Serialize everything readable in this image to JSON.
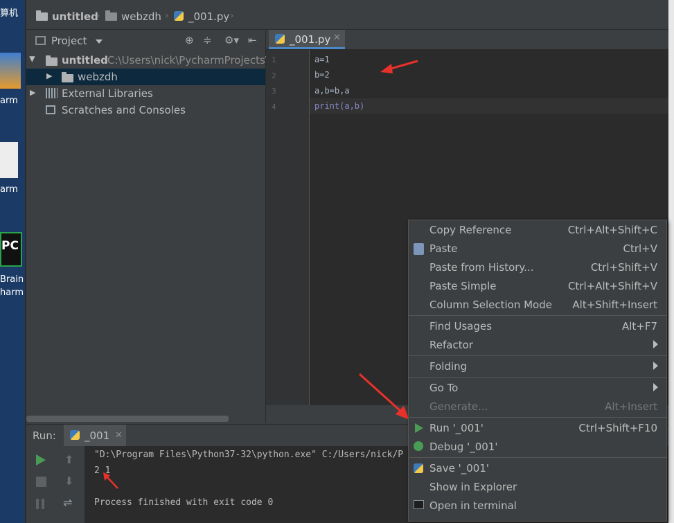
{
  "desktop": {
    "labels": [
      "算机",
      "arm",
      "arm",
      "Brain",
      "harm"
    ],
    "pc_badge": "PC"
  },
  "breadcrumb": {
    "project": "untitled",
    "folder": "webzdh",
    "file": "_001.py"
  },
  "project_panel": {
    "title": "Project",
    "tree": [
      {
        "name": "untitled",
        "path": "C:\\Users\\nick\\PycharmProjects\\"
      },
      {
        "name": "webzdh"
      },
      {
        "name": "External Libraries"
      },
      {
        "name": "Scratches and Consoles"
      }
    ]
  },
  "editor": {
    "tab": "_001.py",
    "lines": [
      {
        "num": "1",
        "code": "a=1"
      },
      {
        "num": "2",
        "code": "b=2"
      },
      {
        "num": "3",
        "code": "a,b=b,a"
      },
      {
        "num": "4",
        "code": "print(a,b)"
      }
    ]
  },
  "run_panel": {
    "label": "Run:",
    "tab": "_001",
    "console": [
      "\"D:\\Program Files\\Python37-32\\python.exe\" C:/Users/nick/P",
      "2 1",
      "",
      "Process finished with exit code 0"
    ]
  },
  "context_menu": {
    "items": [
      {
        "label": "Copy Reference",
        "shortcut": "Ctrl+Alt+Shift+C"
      },
      {
        "label": "Paste",
        "shortcut": "Ctrl+V",
        "icon": "paste-icon"
      },
      {
        "label": "Paste from History...",
        "shortcut": "Ctrl+Shift+V"
      },
      {
        "label": "Paste Simple",
        "shortcut": "Ctrl+Alt+Shift+V"
      },
      {
        "label": "Column Selection Mode",
        "shortcut": "Alt+Shift+Insert"
      },
      {
        "label": "Find Usages",
        "shortcut": "Alt+F7"
      },
      {
        "label": "Refactor",
        "submenu": true
      },
      {
        "label": "Folding",
        "submenu": true
      },
      {
        "label": "Go To",
        "submenu": true
      },
      {
        "label": "Generate...",
        "shortcut": "Alt+Insert",
        "disabled": true
      },
      {
        "label": "Run '_001'",
        "shortcut": "Ctrl+Shift+F10",
        "icon": "run-icon"
      },
      {
        "label": "Debug '_001'",
        "icon": "debug-icon"
      },
      {
        "label": "Save '_001'",
        "icon": "python-icon"
      },
      {
        "label": "Show in Explorer"
      },
      {
        "label": "Open in terminal",
        "icon": "terminal-icon"
      }
    ]
  },
  "colors": {
    "accent": "#4a88c7",
    "run_green": "#499c54",
    "annotation_red": "#e8312a",
    "selection": "#0d293e"
  }
}
